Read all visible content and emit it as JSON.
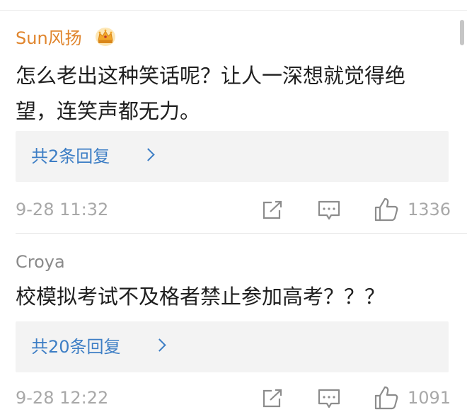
{
  "comments": [
    {
      "username": "Sun风扬",
      "badge_icon": "vip-crown-icon",
      "text": "怎么老出这种笑话呢？让人一深想就觉得绝望，连笑声都无力。",
      "replies_label": "共2条回复",
      "time": "9-28 11:32",
      "likes": "1336"
    },
    {
      "username": "Croya",
      "text": "校模拟考试不及格者禁止参加高考？？？",
      "replies_label": "共20条回复",
      "time": "9-28 12:22",
      "likes": "1091"
    }
  ],
  "colors": {
    "vip_name": "#e0852d",
    "normal_name": "#8a8a8a",
    "link": "#3d7ec5",
    "meta": "#a8a8a8",
    "reply_bg": "#f3f3f3"
  }
}
